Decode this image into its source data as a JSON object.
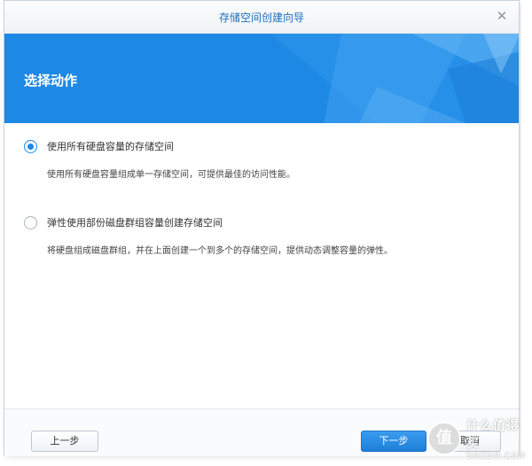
{
  "window": {
    "title": "存储空间创建向导",
    "close_icon": "close-icon"
  },
  "banner": {
    "title": "选择动作",
    "accent_color": "#1e88e5"
  },
  "options": [
    {
      "label": "使用所有硬盘容量的存储空间",
      "description": "使用所有硬盘容量组成单一存储空间，可提供最佳的访问性能。",
      "checked": true
    },
    {
      "label": "弹性使用部份磁盘群组容量创建存储空间",
      "description": "将硬盘组成磁盘群组，并在上面创建一个到多个的存储空间，提供动态调整容量的弹性。",
      "checked": false
    }
  ],
  "footer": {
    "back_label": "上一步",
    "next_label": "下一步",
    "cancel_label": "取消"
  },
  "watermark": {
    "logo_glyph": "值",
    "main": "什么值得买",
    "sub": "SMZDM.COM"
  }
}
